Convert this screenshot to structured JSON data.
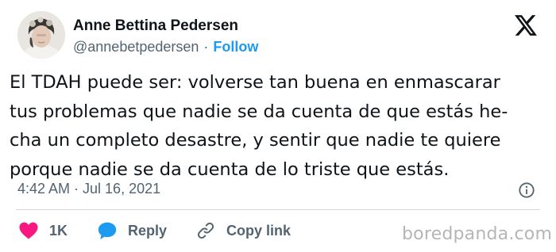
{
  "author": {
    "name": "Anne Bettina Pedersen",
    "handle": "@annebetpedersen",
    "separator": "·",
    "follow_label": "Follow"
  },
  "tweet": {
    "text": "El TDAH puede ser: volverse tan buena en enmascarar\ntus problemas que nadie se da cuenta de que estás he-\ncha un completo desastre, y sentir que nadie te quiere\nporque nadie se da cuenta de lo triste que estás.",
    "timestamp": "4:42 AM · Jul 16, 2021"
  },
  "actions": {
    "like_count": "1K",
    "reply_label": "Reply",
    "copy_link_label": "Copy link"
  },
  "icons": {
    "like": "heart-icon",
    "reply": "speech-bubble-icon",
    "copy": "link-icon",
    "logo": "x-logo-icon",
    "info": "info-icon"
  },
  "colors": {
    "like": "#f91880",
    "reply": "#1d9bf0",
    "follow": "#1d9bf0",
    "muted": "#536471"
  },
  "watermark": "boredpanda.com"
}
